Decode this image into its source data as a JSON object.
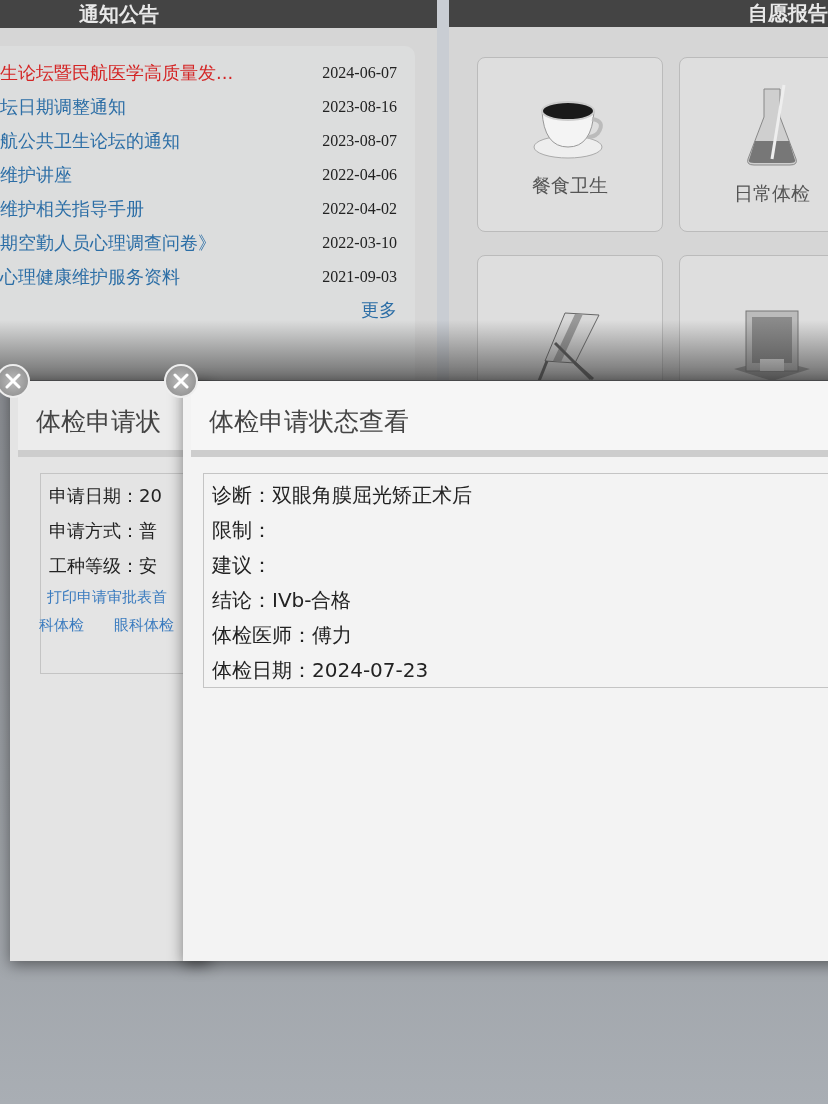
{
  "notices": {
    "title": "通知公告",
    "items": [
      {
        "title": "生论坛暨民航医学高质量发...",
        "date": "2024-06-07",
        "highlighted": true
      },
      {
        "title": "坛日期调整通知",
        "date": "2023-08-16",
        "highlighted": false
      },
      {
        "title": "航公共卫生论坛的通知",
        "date": "2023-08-07",
        "highlighted": false
      },
      {
        "title": "维护讲座",
        "date": "2022-04-06",
        "highlighted": false
      },
      {
        "title": "维护相关指导手册",
        "date": "2022-04-02",
        "highlighted": false
      },
      {
        "title": "期空勤人员心理调查问卷》",
        "date": "2022-03-10",
        "highlighted": false
      },
      {
        "title": "心理健康维护服务资料",
        "date": "2021-09-03",
        "highlighted": false
      }
    ],
    "more": "更多"
  },
  "reports": {
    "title": "自愿报告",
    "cards": [
      {
        "kind": "cup",
        "label": "餐食卫生"
      },
      {
        "kind": "flask",
        "label": "日常体检"
      },
      {
        "kind": "chair"
      },
      {
        "kind": "building"
      }
    ]
  },
  "dialogs": [
    {
      "title": "体检申请状",
      "fields": [
        "申请日期：20",
        "申请方式：普",
        "工种等级：安"
      ],
      "links": [
        [
          "打印申请审批表首"
        ],
        [
          "科体检",
          "眼科体检"
        ]
      ]
    },
    {
      "title": "体检申请状态查看",
      "fields": [
        "诊断：双眼角膜屈光矫正术后",
        "限制：",
        "建议：",
        "结论：IVb-合格",
        "体检医师：傅力",
        "体检日期：2024-07-23"
      ]
    }
  ]
}
